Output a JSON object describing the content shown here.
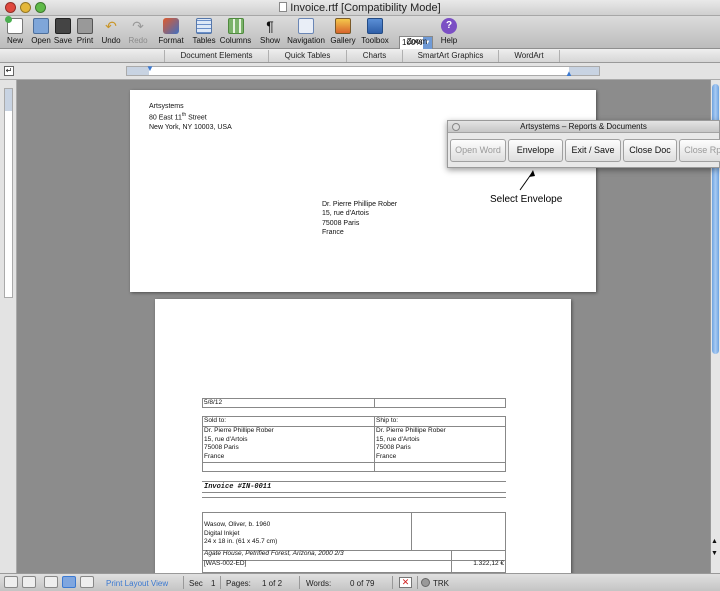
{
  "window": {
    "title": "Invoice.rtf [Compatibility Mode]"
  },
  "toolbar": {
    "items": [
      {
        "label": "New",
        "icon": "new-document-icon"
      },
      {
        "label": "Open",
        "icon": "open-folder-icon"
      },
      {
        "label": "Save",
        "icon": "save-icon"
      },
      {
        "label": "Print",
        "icon": "print-icon"
      },
      {
        "label": "Undo",
        "icon": "undo-icon"
      },
      {
        "label": "Redo",
        "icon": "redo-icon"
      },
      {
        "label": "Format",
        "icon": "format-brush-icon"
      },
      {
        "label": "Tables",
        "icon": "table-icon"
      },
      {
        "label": "Columns",
        "icon": "columns-icon"
      },
      {
        "label": "Show",
        "icon": "pilcrow-icon"
      },
      {
        "label": "Navigation",
        "icon": "navigation-icon"
      },
      {
        "label": "Gallery",
        "icon": "gallery-icon"
      },
      {
        "label": "Toolbox",
        "icon": "toolbox-icon"
      },
      {
        "label": "Zoom",
        "icon": "zoom-icon"
      },
      {
        "label": "Help",
        "icon": "help-icon"
      }
    ],
    "zoom_value": "100%"
  },
  "ribbon": {
    "tabs": [
      "Document Elements",
      "Quick Tables",
      "Charts",
      "SmartArt Graphics",
      "WordArt"
    ]
  },
  "envelope": {
    "return_address": [
      "Artsystems",
      "80 East 11",
      "th",
      " Street",
      "New York, NY 10003, USA"
    ],
    "recipient": [
      "Dr. Pierre Phillipe Rober",
      "15, rue d'Artois",
      "75008 Paris",
      "France"
    ]
  },
  "palette": {
    "title": "Artsystems – Reports & Documents",
    "buttons": [
      "Open Word",
      "Envelope",
      "Exit / Save",
      "Close Doc",
      "Close Rpt"
    ],
    "callout": "Select Envelope"
  },
  "invoice": {
    "date": "5/8/12",
    "sold_to_label": "Sold to:",
    "ship_to_label": "Ship to:",
    "sold_to": [
      "Dr. Pierre Phillipe Rober",
      "15, rue d'Artois",
      "75008 Paris",
      "France"
    ],
    "ship_to": [
      "Dr. Pierre Phillipe Rober",
      "15, rue d'Artois",
      "75008 Paris",
      "France"
    ],
    "invoice_no": "Invoice #IN-0011",
    "artist": "Wasow, Oliver, b. 1960",
    "medium": "Digital Inkjet",
    "size": "24 x 18 in. (61 x 45.7 cm)",
    "title_line": "Agate House, Petrified Forest, Arizona, 2000 2/3",
    "code": "[WAS-002-ED]",
    "price": "1.322,12 €"
  },
  "status": {
    "view_label": "Print Layout View",
    "sec_label": "Sec",
    "sec_value": "1",
    "pages_label": "Pages:",
    "pages_value": "1 of 2",
    "words_label": "Words:",
    "words_value": "0 of 79",
    "trk": "TRK"
  },
  "colors": {
    "accent": "#3b79d1",
    "close": "#e0483e",
    "minimize": "#e4b73a",
    "zoom": "#5fba48"
  }
}
